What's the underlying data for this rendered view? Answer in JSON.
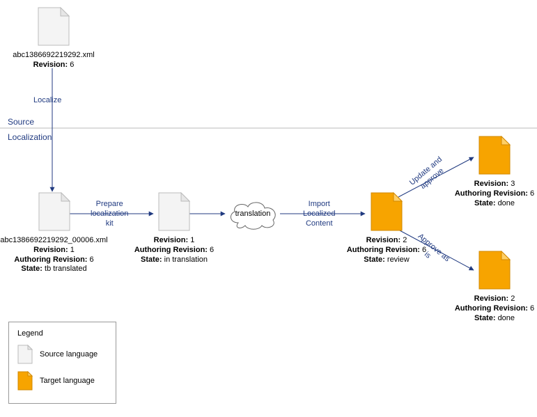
{
  "sections": {
    "source": "Source",
    "localization": "Localization"
  },
  "nodes": {
    "sourceFile": {
      "filename": "abc1386692219292.xml",
      "revision_label": "Revision:",
      "revision": "6"
    },
    "localizedFile": {
      "filename": "abc1386692219292_00006.xml",
      "revision_label": "Revision:",
      "revision": "1",
      "auth_label": "Authoring Revision:",
      "auth": "6",
      "state_label": "State:",
      "state": "tb translated"
    },
    "prepared": {
      "revision_label": "Revision:",
      "revision": "1",
      "auth_label": "Authoring Revision:",
      "auth": "6",
      "state_label": "State:",
      "state": "in translation"
    },
    "translation_cloud": "translation",
    "imported": {
      "revision_label": "Revision:",
      "revision": "2",
      "auth_label": "Authoring Revision:",
      "auth": "6",
      "state_label": "State:",
      "state": "review"
    },
    "updated": {
      "revision_label": "Revision:",
      "revision": "3",
      "auth_label": "Authoring Revision:",
      "auth": "6",
      "state_label": "State:",
      "state": "done"
    },
    "approved": {
      "revision_label": "Revision:",
      "revision": "2",
      "auth_label": "Authoring Revision:",
      "auth": "6",
      "state_label": "State:",
      "state": "done"
    }
  },
  "edges": {
    "localize": "Localize",
    "prepare": "Prepare\nlocalization\nkit",
    "import": "Import\nLocalized\nContent",
    "update_approve": "Update and\napprove",
    "approve_as_is": "Approve as\nis"
  },
  "legend": {
    "title": "Legend",
    "source": "Source language",
    "target": "Target language"
  }
}
